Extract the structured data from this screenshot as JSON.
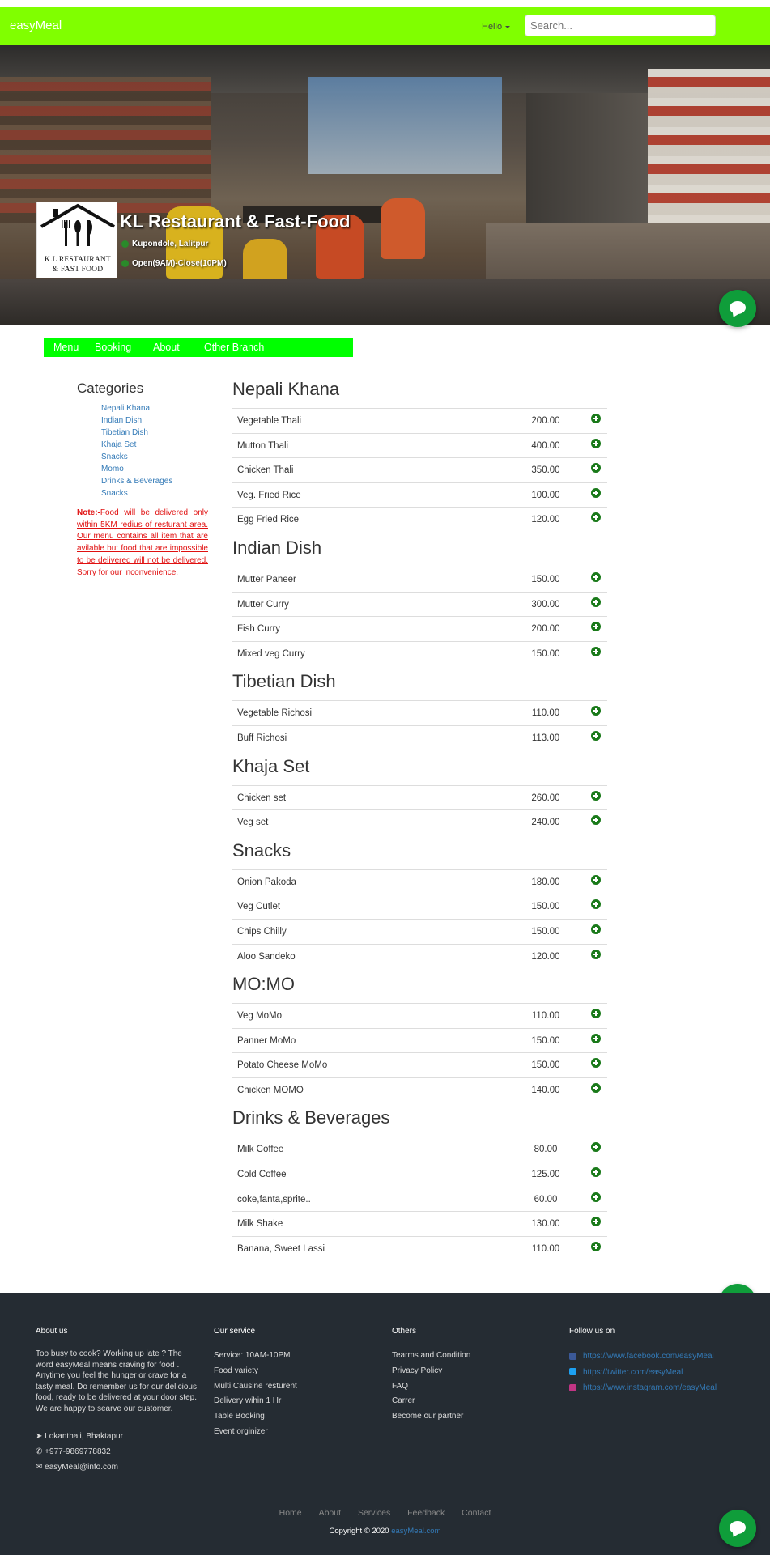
{
  "navbar": {
    "brand": "easyMeal",
    "hello": "Hello",
    "search_placeholder": "Search..."
  },
  "restaurant": {
    "logo_line1": "K.L RESTAURANT",
    "logo_line2": "& FAST FOOD",
    "name": "KL Restaurant & Fast-Food",
    "location": "Kupondole, Lalitpur",
    "hours": "Open(9AM)-Close(10PM)"
  },
  "subnav": [
    "Menu",
    "Booking",
    "About",
    "Other Branch"
  ],
  "sidebar": {
    "title": "Categories",
    "categories": [
      "Nepali Khana",
      "Indian Dish",
      "Tibetian Dish",
      "Khaja Set",
      "Snacks",
      "Momo",
      "Drinks & Beverages",
      "Snacks"
    ],
    "note_label": "Note:-",
    "note_text": "Food will be delivered only within 5KM redius of resturant area. Our menu contains all item that are avilable but food that are impossible to be delivered will not be delivered. Sorry for our inconvenience."
  },
  "menu": [
    {
      "title": "Nepali Khana",
      "items": [
        {
          "name": "Vegetable Thali",
          "price": "200.00"
        },
        {
          "name": "Mutton Thali",
          "price": "400.00"
        },
        {
          "name": "Chicken Thali",
          "price": "350.00"
        },
        {
          "name": "Veg. Fried Rice",
          "price": "100.00"
        },
        {
          "name": "Egg Fried Rice",
          "price": "120.00"
        }
      ]
    },
    {
      "title": "Indian Dish",
      "items": [
        {
          "name": "Mutter Paneer",
          "price": "150.00"
        },
        {
          "name": "Mutter Curry",
          "price": "300.00"
        },
        {
          "name": "Fish Curry",
          "price": "200.00"
        },
        {
          "name": "Mixed veg Curry",
          "price": "150.00"
        }
      ]
    },
    {
      "title": "Tibetian Dish",
      "items": [
        {
          "name": "Vegetable Richosi",
          "price": "110.00"
        },
        {
          "name": "Buff Richosi",
          "price": "113.00"
        }
      ]
    },
    {
      "title": "Khaja Set",
      "items": [
        {
          "name": "Chicken set",
          "price": "260.00"
        },
        {
          "name": "Veg set",
          "price": "240.00"
        }
      ]
    },
    {
      "title": "Snacks",
      "items": [
        {
          "name": "Onion Pakoda",
          "price": "180.00"
        },
        {
          "name": "Veg Cutlet",
          "price": "150.00"
        },
        {
          "name": "Chips Chilly",
          "price": "150.00"
        },
        {
          "name": "Aloo Sandeko",
          "price": "120.00"
        }
      ]
    },
    {
      "title": "MO:MO",
      "items": [
        {
          "name": "Veg MoMo",
          "price": "110.00"
        },
        {
          "name": "Panner MoMo",
          "price": "150.00"
        },
        {
          "name": "Potato Cheese MoMo",
          "price": "150.00"
        },
        {
          "name": "Chicken MOMO",
          "price": "140.00"
        }
      ]
    },
    {
      "title": "Drinks & Beverages",
      "items": [
        {
          "name": "Milk Coffee",
          "price": "80.00"
        },
        {
          "name": "Cold Coffee",
          "price": "125.00"
        },
        {
          "name": "coke,fanta,sprite..",
          "price": "60.00"
        },
        {
          "name": "Milk Shake",
          "price": "130.00"
        },
        {
          "name": "Banana, Sweet Lassi",
          "price": "110.00"
        }
      ]
    }
  ],
  "footer": {
    "about": {
      "title": "About us",
      "text": "Too busy to cook? Working up late ? The word easyMeal means craving for food . Anytime you feel the hunger or crave for a tasty meal. Do remember us for our delicious food, ready to be delivered at your door step. We are happy to searve our customer.",
      "address": "Lokanthali, Bhaktapur",
      "phone": "+977-9869778832",
      "email": "easyMeal@info.com"
    },
    "service": {
      "title": "Our service",
      "items": [
        "Service: 10AM-10PM",
        "Food variety",
        "Multi Causine resturent",
        "Delivery wihin 1 Hr",
        "Table Booking",
        "Event orginizer"
      ]
    },
    "others": {
      "title": "Others",
      "items": [
        "Tearms and Condition",
        "Privacy Policy",
        "FAQ",
        "Carrer",
        "Become our partner"
      ]
    },
    "follow": {
      "title": "Follow us on",
      "links": [
        "https://www.facebook.com/easyMeal",
        "https://twitter.com/easyMeal",
        "https://www.instagram.com/easyMeal"
      ]
    },
    "nav": [
      "Home",
      "About",
      "Services",
      "Feedback",
      "Contact"
    ],
    "copyright": "Copyright © 2020",
    "copyright_link": "easyMeal.com"
  },
  "colors": {
    "navbar": "#80ff00",
    "subnav": "#00ff00",
    "link": "#337ab7",
    "note": "#e01010",
    "add_icon": "#1a7a1a",
    "chat": "#0f9d3a",
    "footer": "#252c33"
  }
}
